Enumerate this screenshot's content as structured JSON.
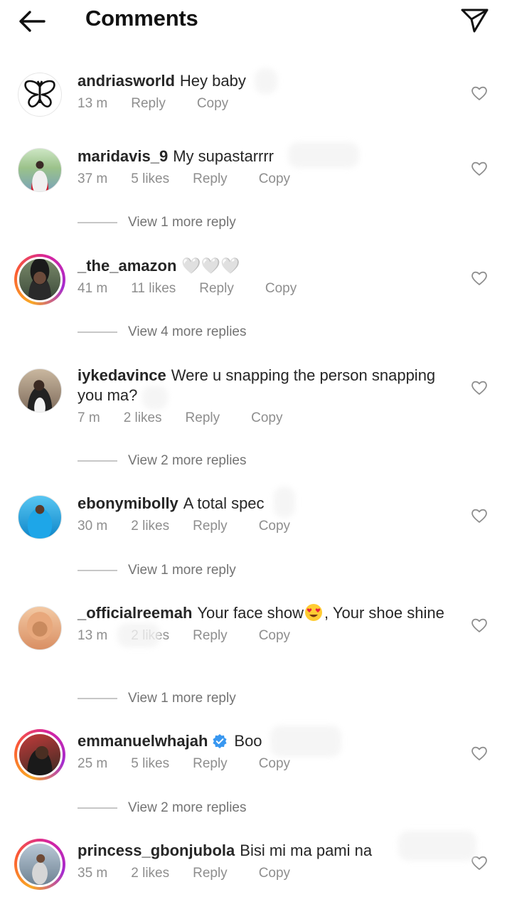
{
  "header": {
    "title": "Comments",
    "back_icon": "arrow-left-icon",
    "share_icon": "paper-plane-icon"
  },
  "colors": {
    "text": "#262626",
    "meta": "#8e8e8e",
    "verified": "#3897f0",
    "story_ring": [
      "#f9a825",
      "#d6249f"
    ]
  },
  "comments": [
    {
      "username": "andriasworld",
      "text": "Hey baby",
      "time": "13 m",
      "likes": "",
      "reply": "Reply",
      "copy": "Copy"
    },
    {
      "username": "maridavis_9",
      "text": "My supastarrrr",
      "time": "37 m",
      "likes": "5 likes",
      "reply": "Reply",
      "copy": "Copy",
      "more": "View 1 more reply"
    },
    {
      "username": "_the_amazon",
      "text": "🤍🤍🤍",
      "time": "41 m",
      "likes": "11 likes",
      "reply": "Reply",
      "copy": "Copy",
      "more": "View 4 more replies"
    },
    {
      "username": "iykedavince",
      "text": "Were u snapping the person snapping you ma?",
      "time": "7 m",
      "likes": "2 likes",
      "reply": "Reply",
      "copy": "Copy",
      "more": "View 2 more replies"
    },
    {
      "username": "ebonymibolly",
      "text": "A total spec",
      "time": "30 m",
      "likes": "2 likes",
      "reply": "Reply",
      "copy": "Copy",
      "more": "View 1 more reply"
    },
    {
      "username": "_officialreemah",
      "text_before": "Your face show",
      "text_after": ", Your shoe shine",
      "time": "13 m",
      "likes": "2 likes",
      "reply": "Reply",
      "copy": "Copy",
      "more": "View 1 more reply"
    },
    {
      "username": "emmanuelwhajah",
      "text": "Boo",
      "verified": true,
      "time": "25 m",
      "likes": "5 likes",
      "reply": "Reply",
      "copy": "Copy",
      "more": "View 2 more replies"
    },
    {
      "username": "princess_gbonjubola",
      "text": "Bisi mi ma pami na",
      "time": "35 m",
      "likes": "2 likes",
      "reply": "Reply",
      "copy": "Copy"
    }
  ]
}
